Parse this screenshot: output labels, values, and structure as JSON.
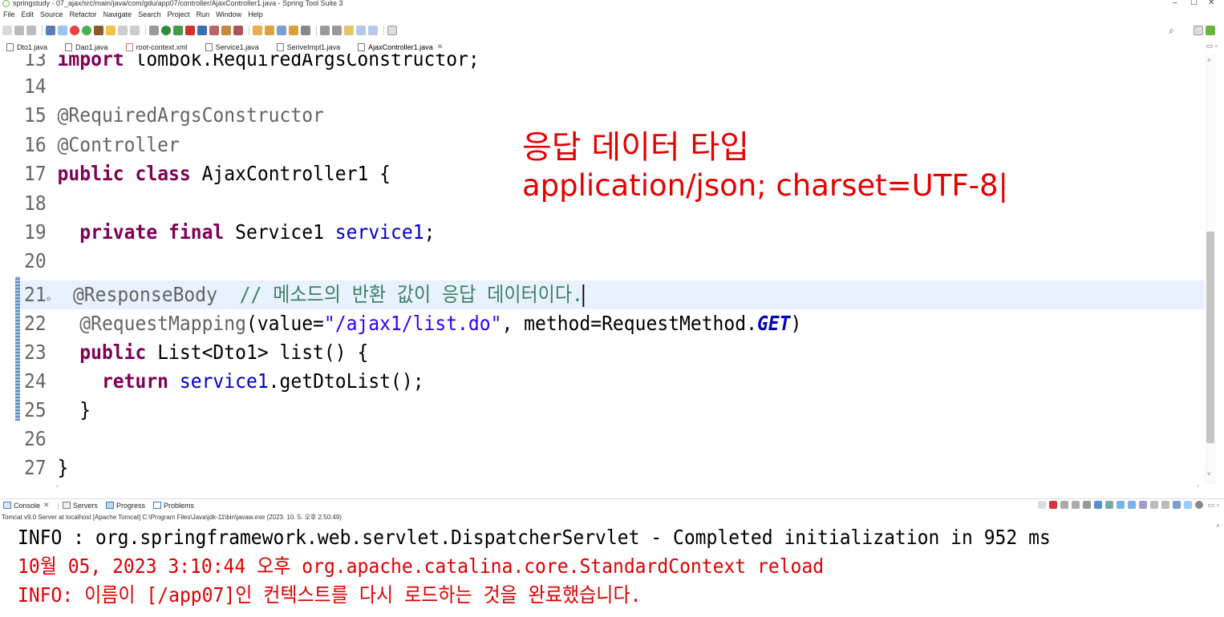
{
  "window": {
    "title": "springstudy - 07_ajax/src/main/java/com/gdu/app07/controller/AjaxController1.java - Spring Tool Suite 3",
    "controls": [
      "–",
      "☐",
      "✕"
    ]
  },
  "menu": [
    "File",
    "Edit",
    "Source",
    "Refactor",
    "Navigate",
    "Search",
    "Project",
    "Run",
    "Window",
    "Help"
  ],
  "editor_tabs": [
    {
      "label": "Dto1.java",
      "active": false
    },
    {
      "label": "Dao1.java",
      "active": false
    },
    {
      "label": "root-context.xml",
      "active": false
    },
    {
      "label": "Service1.java",
      "active": false
    },
    {
      "label": "SeriveImpl1.java",
      "active": false
    },
    {
      "label": "AjaxController1.java",
      "active": true
    }
  ],
  "editor": {
    "lines": {
      "l13": {
        "num": "13",
        "t1": "import",
        "t2": " lombok.RequiredArgsConstructor;"
      },
      "l14": {
        "num": "14"
      },
      "l15": {
        "num": "15",
        "t1": "@RequiredArgsConstructor"
      },
      "l16": {
        "num": "16",
        "t1": "@Controller"
      },
      "l17": {
        "num": "17",
        "t1": "public",
        "t2": "class",
        "t3": "AjaxController1 {"
      },
      "l18": {
        "num": "18"
      },
      "l19": {
        "num": "19",
        "t1": "private",
        "t2": "final",
        "t3": "Service1",
        "t4": "service1",
        "t5": ";"
      },
      "l20": {
        "num": "20"
      },
      "l21": {
        "num": "21",
        "t1": "@ResponseBody",
        "t2": "// 메소드의 반환 값이 응답 데이터이다."
      },
      "l22": {
        "num": "22",
        "t1": "@RequestMapping",
        "t2": "(value=",
        "t3": "\"/ajax1/list.do\"",
        "t4": ", method=RequestMethod.",
        "t5": "GET",
        "t6": ")"
      },
      "l23": {
        "num": "23",
        "t1": "public",
        "t2": "List<Dto1> list() {"
      },
      "l24": {
        "num": "24",
        "t1": "return",
        "t2": "service1",
        "t3": ".getDtoList();"
      },
      "l25": {
        "num": "25",
        "t1": "}"
      },
      "l26": {
        "num": "26"
      },
      "l27": {
        "num": "27",
        "t1": "}"
      }
    }
  },
  "annotation_overlay": {
    "line1": "응답 데이터 타입",
    "line2": "application/json; charset=UTF-8|"
  },
  "console_view": {
    "tabs": [
      "Console",
      "Servers",
      "Progress",
      "Problems"
    ],
    "description": "Tomcat v9.0 Server at localhost [Apache Tomcat] C:\\Program Files\\Java\\jdk-11\\bin\\javaw.exe  (2023. 10. 5. 오후 2:50:49)",
    "lines": [
      "INFO : org.springframework.web.servlet.DispatcherServlet - Completed initialization in 952 ms",
      "10월 05, 2023 3:10:44 오후 org.apache.catalina.core.StandardContext reload",
      "INFO: 이름이 [/app07]인 컨텍스트를 다시 로드하는 것을 완료했습니다."
    ]
  },
  "colors": {
    "keyword": "#7f0055",
    "annotation": "#646464",
    "string": "#2a00ff",
    "field": "#0000c0",
    "comment": "#3f7f5f",
    "overlay_red": "#e60000",
    "console_error": "#e00000",
    "current_line": "#e8f2fe"
  }
}
